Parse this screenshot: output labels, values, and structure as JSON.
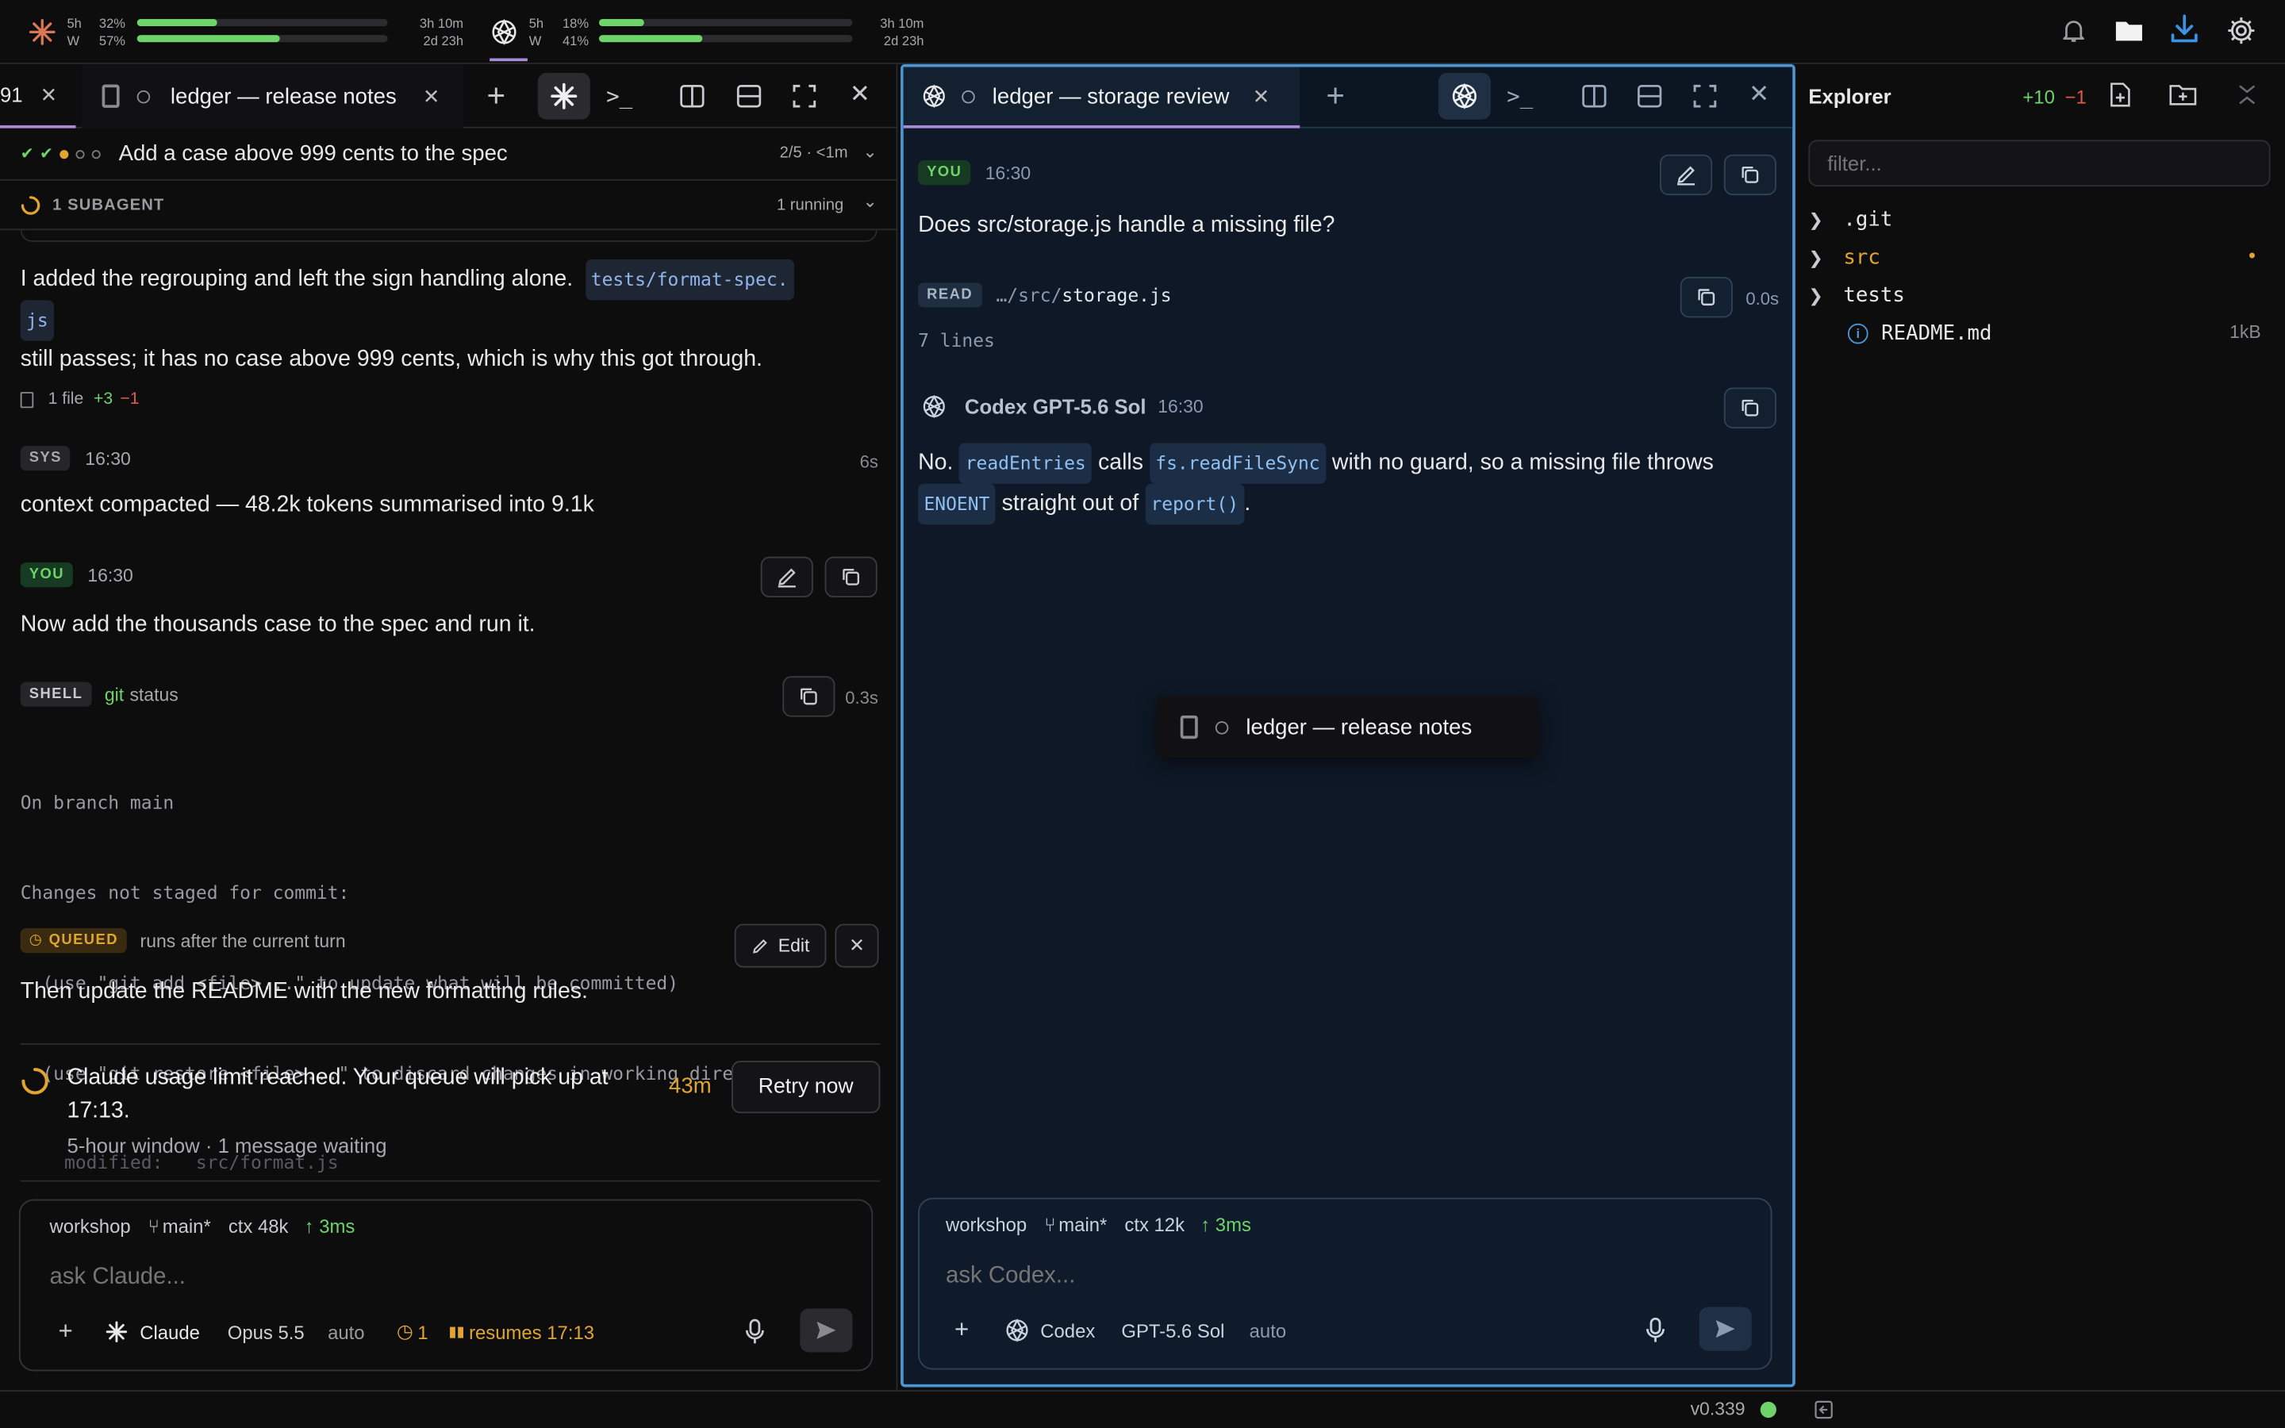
{
  "topbar": {
    "claude": {
      "window_label": "5h",
      "week_label": "W",
      "five_hour_pct": "32%",
      "five_hour_fill": 0.32,
      "week_pct": "57%",
      "week_fill": 0.57,
      "reset_short": "3h 10m",
      "reset_long": "2d 23h"
    },
    "codex": {
      "window_label": "5h",
      "week_label": "W",
      "five_hour_pct": "18%",
      "five_hour_fill": 0.18,
      "week_pct": "41%",
      "week_fill": 0.41,
      "reset_short": "3h 10m",
      "reset_long": "2d 23h"
    },
    "icons": [
      "bell-icon",
      "folder-icon",
      "download-icon",
      "gear-icon"
    ],
    "download_color": "#3b93e6"
  },
  "left": {
    "tabs": {
      "first_fragment": "91",
      "second_label": "ledger — release notes"
    },
    "task": {
      "title": "Add a case above 999 cents to the spec",
      "progress": "2/5 · <1m"
    },
    "subagent": {
      "label": "1 SUBAGENT",
      "status": "1 running"
    },
    "msg1": {
      "part1": "I added the regrouping and left the sign handling alone.",
      "code1": "tests/format-spec.",
      "code1b": "js",
      "part2": "still passes; it has no case above 999 cents, which is why this got through.",
      "files": "1 file",
      "added": "+3",
      "removed": "−1"
    },
    "sys": {
      "tag": "SYS",
      "time": "16:30",
      "duration": "6s",
      "text": "context compacted — 48.2k tokens summarised into 9.1k"
    },
    "you": {
      "tag": "YOU",
      "time": "16:30",
      "text": "Now add the thousands case to the spec and run it."
    },
    "shell": {
      "tag": "SHELL",
      "cmd_keyword": "git",
      "cmd_rest": "status",
      "duration": "0.3s",
      "lines": [
        "On branch main",
        "Changes not staged for commit:",
        "  (use \"git add <file>...\" to update what will be committed)",
        "  (use \"git restore <file>...\" to discard changes in working directory)",
        "    modified:   src/format.js"
      ]
    },
    "queued": {
      "tag": "QUEUED",
      "note": "runs after the current turn",
      "edit_label": "Edit",
      "text": "Then update the README with the new formatting rules."
    },
    "limit": {
      "title": "Claude usage limit reached. Your queue will pick up at 17:13.",
      "sub": "5-hour window · 1 message waiting",
      "countdown": "43m",
      "retry_label": "Retry now"
    },
    "composer": {
      "workspace": "workshop",
      "branch": "main*",
      "ctx": "ctx 48k",
      "latency": "↑ 3ms",
      "placeholder": "ask Claude...",
      "agent": "Claude",
      "model": "Opus 5.5",
      "mode": "auto",
      "queue_count": "1",
      "resume": "resumes 17:13"
    }
  },
  "codex": {
    "tab_label": "ledger — storage review",
    "you": {
      "tag": "YOU",
      "time": "16:30",
      "text": "Does src/storage.js handle a missing file?"
    },
    "read": {
      "tag": "READ",
      "path_prefix": "…/src/",
      "path_file": "storage.js",
      "duration": "0.0s",
      "lines": "7 lines"
    },
    "reply": {
      "author": "Codex GPT-5.6 Sol",
      "time": "16:30",
      "t1": "No.",
      "c1": "readEntries",
      "t2": "calls",
      "c2": "fs.readFileSync",
      "t3": "with no guard, so a missing file throws",
      "c3": "ENOENT",
      "t4": "straight out of",
      "c4": "report()",
      "t5": "."
    },
    "drag_ghost": "ledger — release notes",
    "composer": {
      "workspace": "workshop",
      "branch": "main*",
      "ctx": "ctx 12k",
      "latency": "↑ 3ms",
      "placeholder": "ask Codex...",
      "agent": "Codex",
      "model": "GPT-5.6 Sol",
      "mode": "auto"
    }
  },
  "explorer": {
    "title": "Explorer",
    "added": "+10",
    "removed": "−1",
    "filter_placeholder": "filter...",
    "items": [
      {
        "name": ".git"
      },
      {
        "name": "src",
        "badge": "•"
      },
      {
        "name": "tests"
      },
      {
        "name": "README.md",
        "size": "1kB"
      }
    ]
  },
  "footer": {
    "version": "v0.339",
    "status_color": "#6ed46a"
  }
}
